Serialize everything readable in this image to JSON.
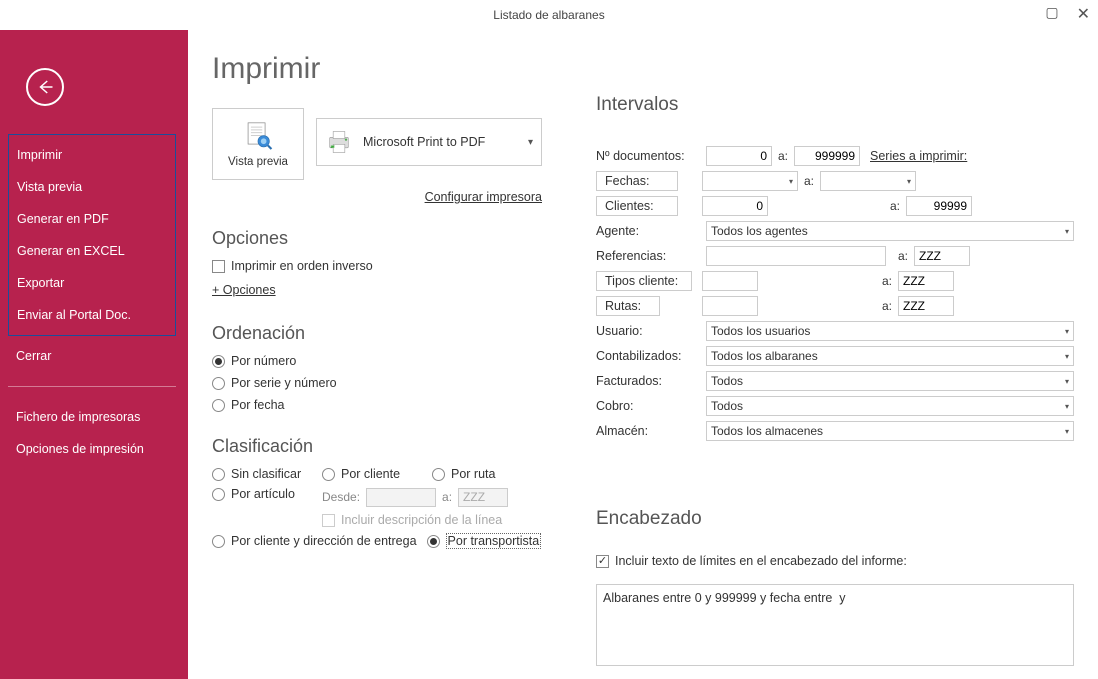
{
  "titlebar": {
    "title": "Listado de albaranes"
  },
  "sidebar": {
    "items": [
      "Imprimir",
      "Vista previa",
      "Generar en PDF",
      "Generar en EXCEL",
      "Exportar",
      "Enviar al Portal Doc."
    ],
    "cerrar": "Cerrar",
    "fichero": "Fichero de impresoras",
    "opciones": "Opciones de impresión"
  },
  "page": {
    "title": "Imprimir",
    "preview_label": "Vista previa",
    "printer_name": "Microsoft Print to PDF",
    "config_link": "Configurar impresora"
  },
  "opciones": {
    "head": "Opciones",
    "inverso": "Imprimir en orden inverso",
    "mas": "+ Opciones"
  },
  "orden": {
    "head": "Ordenación",
    "r1": "Por número",
    "r2": "Por serie y número",
    "r3": "Por fecha"
  },
  "clasif": {
    "head": "Clasificación",
    "sin": "Sin clasificar",
    "cliente": "Por cliente",
    "ruta": "Por ruta",
    "articulo": "Por artículo",
    "desde": "Desde:",
    "a": "a:",
    "zzz": "ZZZ",
    "incluir_desc": "Incluir descripción de la línea",
    "cliente_dir": "Por cliente y dirección de entrega",
    "transportista": "Por transportista"
  },
  "intervalos": {
    "head": "Intervalos",
    "ndoc": "Nº documentos:",
    "ndoc_from": "0",
    "ndoc_to": "999999",
    "series_link": "Series a imprimir:",
    "fechas": "Fechas:",
    "clientes": "Clientes:",
    "clientes_from": "0",
    "clientes_to": "99999",
    "agente": "Agente:",
    "agente_val": "Todos los agentes",
    "refs": "Referencias:",
    "refs_to": "ZZZ",
    "tipos": "Tipos cliente:",
    "tipos_to": "ZZZ",
    "rutas": "Rutas:",
    "rutas_to": "ZZZ",
    "usuario": "Usuario:",
    "usuario_val": "Todos los usuarios",
    "contab": "Contabilizados:",
    "contab_val": "Todos los albaranes",
    "fact": "Facturados:",
    "fact_val": "Todos",
    "cobro": "Cobro:",
    "cobro_val": "Todos",
    "almacen": "Almacén:",
    "almacen_val": "Todos los almacenes",
    "a": "a:"
  },
  "encabezado": {
    "head": "Encabezado",
    "incluir": "Incluir texto de límites en el encabezado del informe:",
    "text": "Albaranes entre 0 y 999999 y fecha entre  y"
  }
}
